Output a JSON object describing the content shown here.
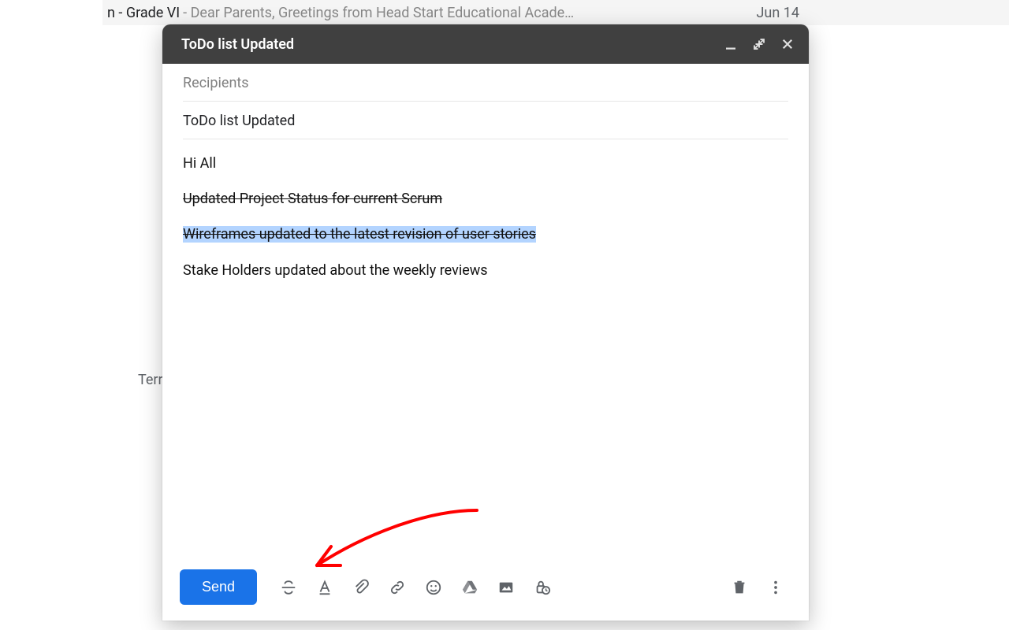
{
  "background": {
    "row_title_fragment": "n - Grade VI",
    "row_preview": " - Dear Parents, Greetings from Head Start Educational Acade…",
    "row_date": "Jun 14",
    "terr_text": "Terr"
  },
  "compose": {
    "header_title": "ToDo list Updated",
    "recipients_placeholder": "Recipients",
    "subject": "ToDo list Updated",
    "body": {
      "greeting": "Hi All",
      "line1": "Updated Project Status for current Scrum ",
      "line2": "Wireframes updated to the latest revision of user stories",
      "line3": "Stake Holders updated about the weekly reviews"
    },
    "send_label": "Send"
  }
}
